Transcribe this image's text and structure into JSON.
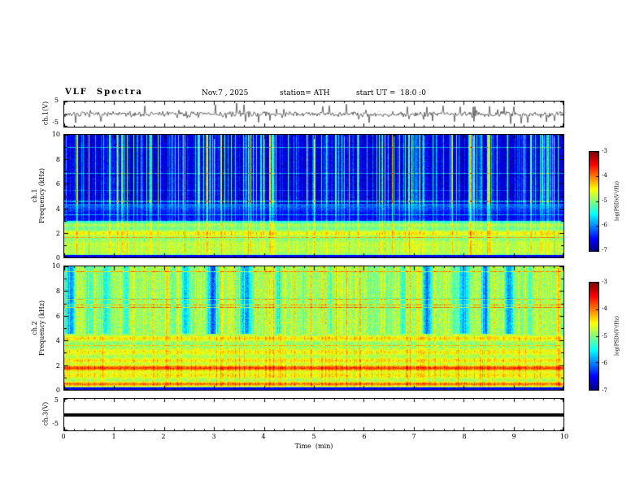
{
  "header": {
    "title": "VLF  Spectra",
    "date": "Nov.7 , 2025",
    "station": "station= ATH",
    "start_ut": "start UT =  18:0 :0"
  },
  "panels": {
    "wave1": {
      "label": "ch.1(V)",
      "ymax": "5",
      "ymin": "-5"
    },
    "spec1": {
      "channel": "ch.1",
      "axis": "Frequency (kHz)",
      "yticks": [
        "10",
        "8",
        "6",
        "4",
        "2",
        "0"
      ]
    },
    "spec2": {
      "channel": "ch.2",
      "axis": "Frequency (kHz)",
      "yticks": [
        "10",
        "8",
        "6",
        "4",
        "2",
        "0"
      ]
    },
    "wave3": {
      "label": "ch.3(V)",
      "ymax": "5",
      "ymin": "-5"
    }
  },
  "xaxis": {
    "label": "Time  (min)",
    "ticks": [
      "0",
      "1",
      "2",
      "3",
      "4",
      "5",
      "6",
      "7",
      "8",
      "9",
      "10"
    ]
  },
  "colorbar": {
    "label": "log(PSD)(V²/Hz)",
    "ticks": [
      "-3",
      "-4",
      "-5",
      "-6",
      "-7"
    ],
    "colormap": "jet",
    "range_log10": [
      -7,
      -3
    ]
  },
  "chart_data": [
    {
      "type": "line",
      "panel": "ch.1(V) raw waveform",
      "xlabel": "Time (min)",
      "ylabel": "ch.1(V)",
      "xlim": [
        0,
        10
      ],
      "ylim": [
        -5,
        5
      ],
      "description": "Continuous broadband noise centered on 0 V (typical ±1 V) with dense impulsive sferic spikes reaching toward the ±5 V limits throughout the 10-minute record"
    },
    {
      "type": "heatmap",
      "panel": "ch.1 spectrogram",
      "xlabel": "Time (min)",
      "ylabel": "Frequency (kHz)",
      "xlim": [
        0,
        10
      ],
      "ylim": [
        0,
        10
      ],
      "zlabel": "log(PSD)(V²/Hz)",
      "zlim": [
        -7,
        -3
      ],
      "colormap": "jet",
      "bands": [
        {
          "freq_khz": 2.0,
          "width_khz": 0.18,
          "psd_boost": 0.6,
          "note": "bright yellow-green quasi-continuous band"
        },
        {
          "freq_khz": 1.1,
          "width_khz": 0.3,
          "psd_boost": 0.35
        },
        {
          "freq_khz": 2.7,
          "width_khz": 0.15,
          "psd_boost": 0.45
        },
        {
          "freq_khz": 3.4,
          "width_khz": 0.5,
          "psd_boost": -0.55,
          "note": "darker blue zone with thin cyan horizontal interference lines"
        },
        {
          "freq_khz": 0.5,
          "width_khz": 0.2,
          "psd_boost": 0.3
        }
      ],
      "features": [
        "4-10 kHz: dark navy background (~ -6.8) crossed by dense thin vertical green/yellow sferic streaks",
        "0.3-4 kHz: cyan-green mottled background (~ -5)",
        "horizontal interference lines scattered through 3-6 kHz",
        "very bottom (<0.2 kHz): dark band"
      ]
    },
    {
      "type": "heatmap",
      "panel": "ch.2 spectrogram",
      "xlabel": "Time (min)",
      "ylabel": "Frequency (kHz)",
      "xlim": [
        0,
        10
      ],
      "ylim": [
        0,
        10
      ],
      "zlabel": "log(PSD)(V²/Hz)",
      "zlim": [
        -7,
        -3
      ],
      "colormap": "jet",
      "bands": [
        {
          "freq_khz": 1.8,
          "width_khz": 0.15,
          "psd_boost": 1.2,
          "note": "strong orange-red horizontal band"
        },
        {
          "freq_khz": 0.5,
          "width_khz": 0.12,
          "psd_boost": 1.0,
          "note": "orange band near bottom"
        },
        {
          "freq_khz": 1.2,
          "width_khz": 0.2,
          "psd_boost": 0.5
        },
        {
          "freq_khz": 2.4,
          "width_khz": 0.15,
          "psd_boost": 0.55
        },
        {
          "freq_khz": 3.1,
          "width_khz": 0.2,
          "psd_boost": 0.45
        },
        {
          "freq_khz": 4.2,
          "width_khz": 0.15,
          "psd_boost": 0.55
        }
      ],
      "features": [
        "4.5-10 kHz: green background alternating with broad dark-blue vertical gaps and thin bright sferic streaks",
        "0-4.5 kHz: strong green/cyan horizontal banding with orange lines near 1.8 and 0.5 kHz",
        "very bottom (<0.2 kHz): dark band"
      ]
    },
    {
      "type": "line",
      "panel": "ch.3(V) raw waveform",
      "xlabel": "Time (min)",
      "ylabel": "ch.3(V)",
      "xlim": [
        0,
        10
      ],
      "ylim": [
        -5,
        5
      ],
      "description": "Flat constant trace at 0 V (thick solid line) — no signal on channel 3"
    }
  ]
}
